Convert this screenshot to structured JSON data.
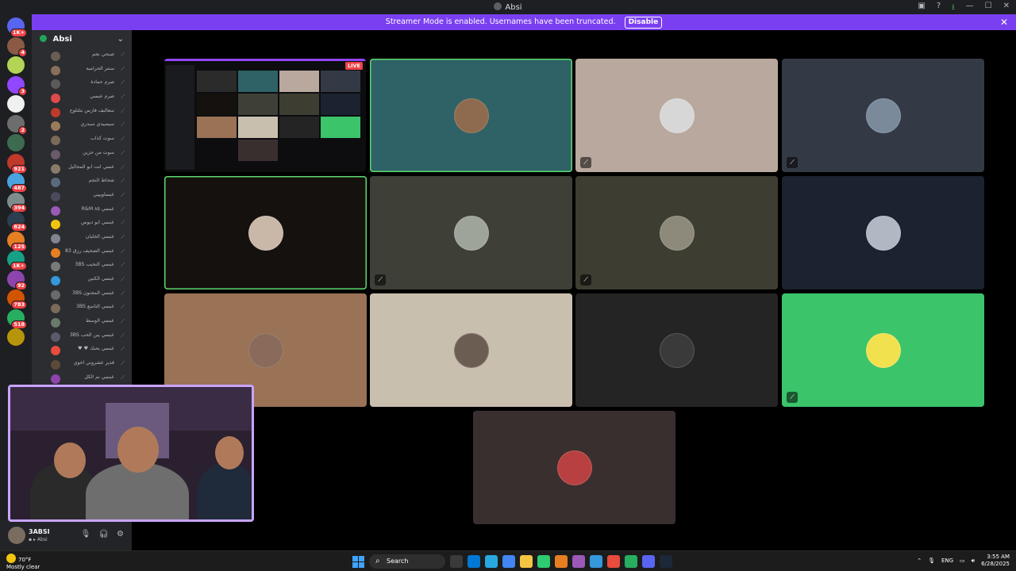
{
  "window": {
    "title": "Absi"
  },
  "banner": {
    "text": "Streamer Mode is enabled. Usernames have been truncated.",
    "disable_label": "Disable",
    "color": "#7b3ff2"
  },
  "servers": [
    {
      "color": "#5865f2",
      "badge": "1K+"
    },
    {
      "color": "#8a5a44",
      "badge": "4"
    },
    {
      "color": "#b4d455",
      "badge": ""
    },
    {
      "color": "#9146ff",
      "badge": "3"
    },
    {
      "color": "#f0f0f0",
      "badge": ""
    },
    {
      "color": "#6d6d6d",
      "badge": "2"
    },
    {
      "color": "#3d6b4f",
      "badge": ""
    },
    {
      "color": "#c0392b",
      "badge": "921"
    },
    {
      "color": "#4aa3df",
      "badge": "487"
    },
    {
      "color": "#7f8c8d",
      "badge": "394"
    },
    {
      "color": "#2c3e50",
      "badge": "824"
    },
    {
      "color": "#e67e22",
      "badge": "125"
    },
    {
      "color": "#16a085",
      "badge": "1K+"
    },
    {
      "color": "#8e44ad",
      "badge": "92"
    },
    {
      "color": "#d35400",
      "badge": "783"
    },
    {
      "color": "#27ae60",
      "badge": "518"
    },
    {
      "color": "#b7950b",
      "badge": ""
    }
  ],
  "channel": {
    "name": "Absi",
    "members": [
      {
        "name": "صبحي نجم",
        "color": "#6b5d52"
      },
      {
        "name": "سنتر الحرامية",
        "color": "#8a6f5a"
      },
      {
        "name": "صرم حمادة",
        "color": "#5a5a5a"
      },
      {
        "name": "صرم عبسي",
        "color": "#e04a4a"
      },
      {
        "name": "سعاليف فارس بتلتلوح",
        "color": "#c0392b"
      },
      {
        "name": "سيمبيدي سبدري",
        "color": "#9a7a5a"
      },
      {
        "name": "سوت كذاب",
        "color": "#7a6a5a"
      },
      {
        "name": "سوت من حزين",
        "color": "#6a5a6a"
      },
      {
        "name": "عسي انت ابو المحاليل",
        "color": "#8a7a6a"
      },
      {
        "name": "شحاط النجم",
        "color": "#5a6a7a"
      },
      {
        "name": "عبساويييي",
        "color": "#4a4a5a"
      },
      {
        "name": "عبسي ٨٥ R&M",
        "color": "#9b59b6"
      },
      {
        "name": "عبسي ابو ديوس",
        "color": "#f1c40f"
      },
      {
        "name": "عبسي الخلبان",
        "color": "#80848e"
      },
      {
        "name": "عبسي الصحيف رزق 83",
        "color": "#e67e22"
      },
      {
        "name": "عبسي النجيب 3BS",
        "color": "#7a7a7a"
      },
      {
        "name": "عبسي الكنين",
        "color": "#3498db"
      },
      {
        "name": "عبسي المجنون 3BS",
        "color": "#6a6a6a"
      },
      {
        "name": "عبسي التاسع 3BS",
        "color": "#7a6a5a"
      },
      {
        "name": "عبسي الوسط",
        "color": "#6a7a6a"
      },
      {
        "name": "عبسي يبن الحب 3BS",
        "color": "#5a5a6a"
      },
      {
        "name": "عبسي يحبك ♥ ♥",
        "color": "#e74c3c"
      },
      {
        "name": "قدير عشروني اخوي",
        "color": "#5a4a3a"
      },
      {
        "name": "عبسي نم الكل",
        "color": "#8e44ad"
      }
    ]
  },
  "user": {
    "name": "3ABSI",
    "status": "Absi"
  },
  "tiles": [
    {
      "name": "tile-1",
      "bg": "#2e6266",
      "avatar": "#8e6b4f",
      "muted": false,
      "speaking": true
    },
    {
      "name": "tile-2",
      "bg": "#b9a89d",
      "avatar": "#d7d7d7",
      "muted": true,
      "speaking": false
    },
    {
      "name": "tile-3",
      "bg": "#343a45",
      "avatar": "#7a8a9a",
      "muted": true,
      "speaking": false
    },
    {
      "name": "tile-4",
      "bg": "#15110e",
      "avatar": "#c9b8a8",
      "muted": false,
      "speaking": true
    },
    {
      "name": "tile-5",
      "bg": "#3e3f37",
      "avatar": "#9fa49a",
      "muted": true,
      "speaking": false
    },
    {
      "name": "tile-6",
      "bg": "#3d3d32",
      "avatar": "#8d8a7b",
      "muted": true,
      "speaking": false
    },
    {
      "name": "tile-7",
      "bg": "#1b2230",
      "avatar": "#b0b8c4",
      "muted": false,
      "speaking": false
    },
    {
      "name": "tile-8",
      "bg": "#9a7255",
      "avatar": "#8a6a5a",
      "muted": false,
      "speaking": false
    },
    {
      "name": "tile-9",
      "bg": "#c9bfaf",
      "avatar": "#6b5d52",
      "muted": false,
      "speaking": false
    },
    {
      "name": "tile-10",
      "bg": "#242424",
      "avatar": "#3a3a3a",
      "muted": false,
      "speaking": false
    },
    {
      "name": "tile-11",
      "bg": "#3bc46a",
      "avatar": "#f2e14f",
      "muted": true,
      "speaking": false
    },
    {
      "name": "tile-12",
      "bg": "#3a2f2f",
      "avatar": "#b84040",
      "muted": false,
      "speaking": false
    }
  ],
  "stream": {
    "live_label": "LIVE",
    "minis": [
      "#2b2b2b",
      "#2e6266",
      "#b9a89d",
      "#343a45",
      "#15110e",
      "#3e3f37",
      "#3d3d32",
      "#1b2230",
      "#9a7255",
      "#c9bfaf",
      "#242424",
      "#3bc46a",
      "#3a2f2f"
    ]
  },
  "taskbar": {
    "weather_temp": "70°F",
    "weather_desc": "Mostly clear",
    "search_label": "Search",
    "apps": [
      "#3a3a3a",
      "#0078d4",
      "#29a8e0",
      "#4285f4",
      "#f4c542",
      "#2ecc71",
      "#e67e22",
      "#9b59b6",
      "#3498db",
      "#e74c3c",
      "#27ae60",
      "#5865f2",
      "#1b2838"
    ],
    "lang": "ENG",
    "time": "3:55 AM",
    "date": "6/28/2025"
  }
}
